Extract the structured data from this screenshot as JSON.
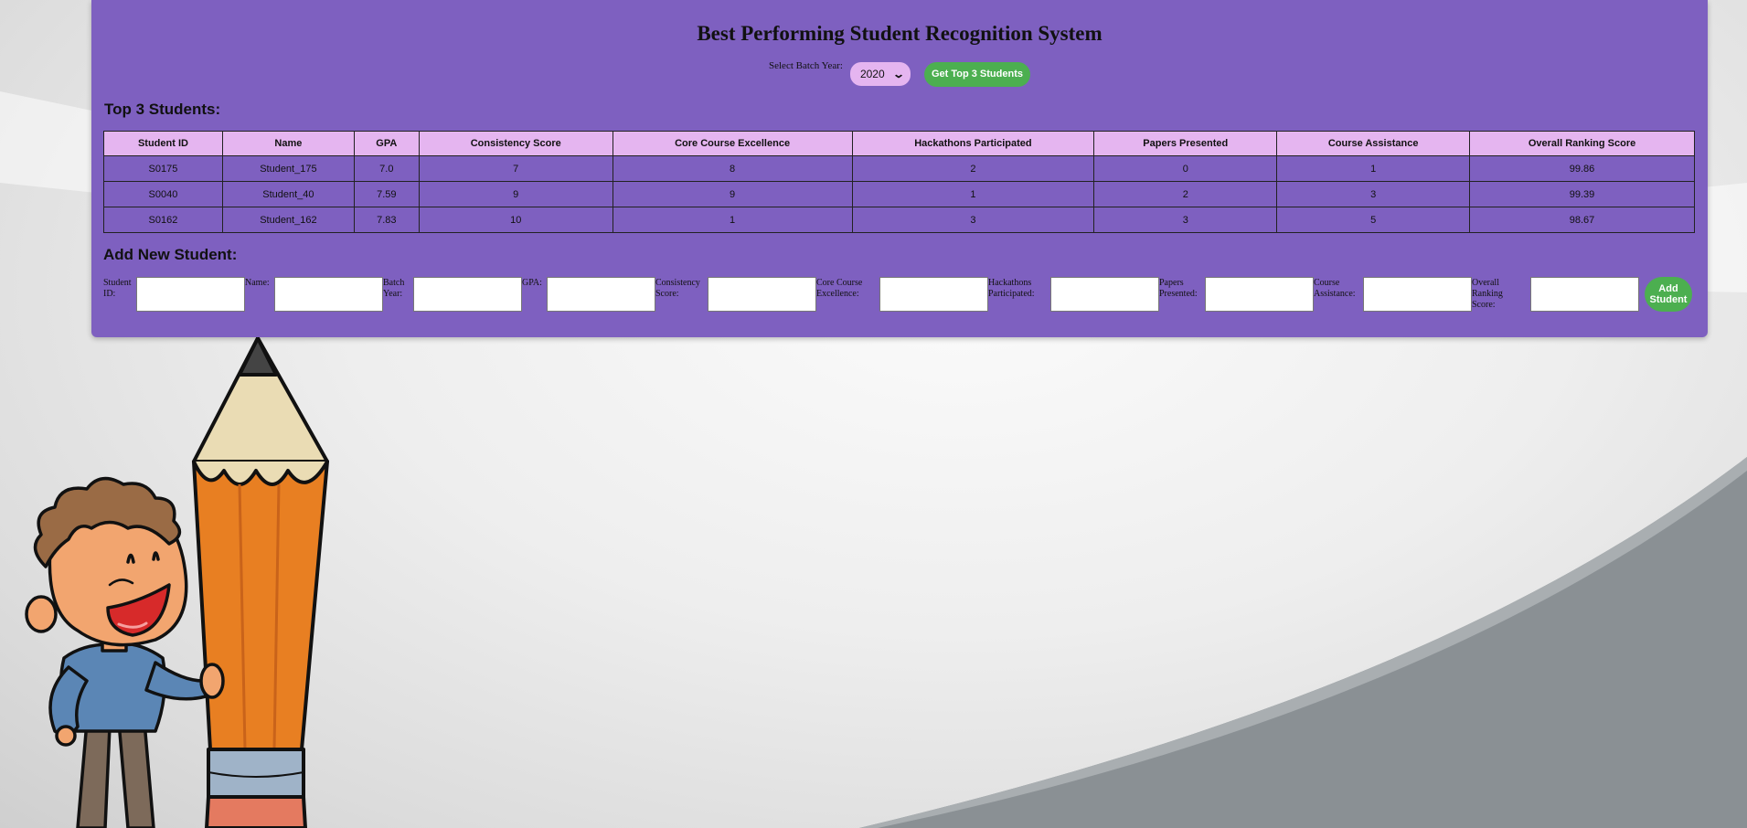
{
  "header": {
    "title": "Best Performing Student Recognition System",
    "batch_label": "Select Batch Year:",
    "batch_value": "2020",
    "get_top_button": "Get Top 3 Students"
  },
  "top_section": {
    "heading": "Top 3 Students:",
    "columns": [
      "Student ID",
      "Name",
      "GPA",
      "Consistency Score",
      "Core Course Excellence",
      "Hackathons Participated",
      "Papers Presented",
      "Course Assistance",
      "Overall Ranking Score"
    ],
    "rows": [
      [
        "S0175",
        "Student_175",
        "7.0",
        "7",
        "8",
        "2",
        "0",
        "1",
        "99.86"
      ],
      [
        "S0040",
        "Student_40",
        "7.59",
        "9",
        "9",
        "1",
        "2",
        "3",
        "99.39"
      ],
      [
        "S0162",
        "Student_162",
        "7.83",
        "10",
        "1",
        "3",
        "3",
        "5",
        "98.67"
      ]
    ]
  },
  "add_section": {
    "heading": "Add New Student:",
    "fields": [
      {
        "label_lines": [
          "Student",
          "ID:"
        ]
      },
      {
        "label_lines": [
          "Name:"
        ]
      },
      {
        "label_lines": [
          "Batch",
          "Year:"
        ]
      },
      {
        "label_lines": [
          "GPA:"
        ]
      },
      {
        "label_lines": [
          "Consistency",
          "Score:"
        ]
      },
      {
        "label_lines": [
          "Core Course",
          "Excellence:"
        ]
      },
      {
        "label_lines": [
          "Hackathons",
          "Participated:"
        ]
      },
      {
        "label_lines": [
          "Papers",
          "Presented:"
        ]
      },
      {
        "label_lines": [
          "Course",
          "Assistance:"
        ]
      },
      {
        "label_lines": [
          "Overall",
          "Ranking",
          "Score:"
        ]
      }
    ],
    "add_button_lines": [
      "Add",
      "Student"
    ]
  },
  "colors": {
    "panel": "#7e60c0",
    "header_cell": "#e5b5f0",
    "button_green": "#4caf50"
  },
  "background": {
    "illustration": "cartoon-boy-with-giant-pencil"
  }
}
